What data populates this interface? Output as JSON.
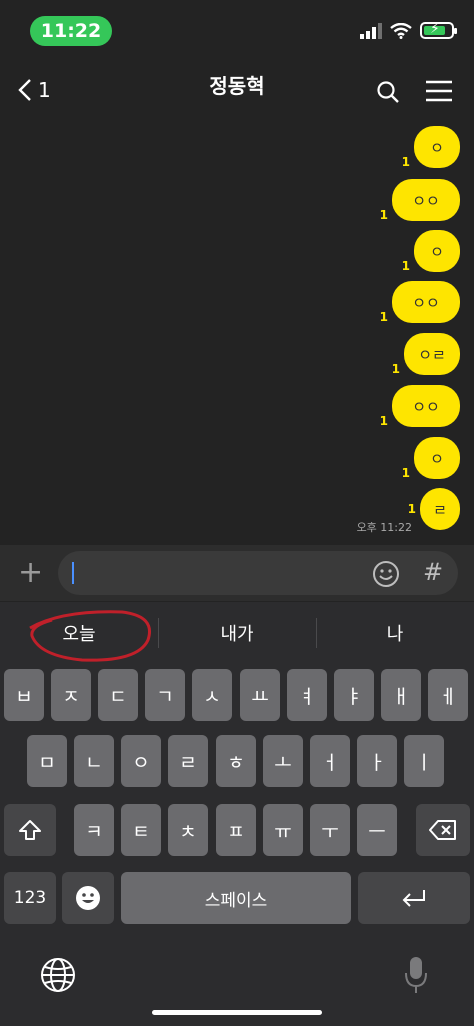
{
  "status_bar": {
    "time": "11:22"
  },
  "header": {
    "back_count": "1",
    "title": "정동혁"
  },
  "messages": [
    {
      "text": "ㅇ",
      "read": "1"
    },
    {
      "text": "ㅇㅇ",
      "read": "1"
    },
    {
      "text": "ㅇ",
      "read": "1"
    },
    {
      "text": "ㅇㅇ",
      "read": "1"
    },
    {
      "text": "ㅇㄹ",
      "read": "1"
    },
    {
      "text": "ㅇㅇ",
      "read": "1"
    },
    {
      "text": "ㅇ",
      "read": "1"
    },
    {
      "text": "ㄹ",
      "read": "1"
    }
  ],
  "timestamp": "오후 11:22",
  "input_bar": {
    "plus": "+",
    "hash": "#"
  },
  "suggestions": [
    "오늘",
    "내가",
    "나"
  ],
  "keyboard": {
    "row1": [
      "ㅂ",
      "ㅈ",
      "ㄷ",
      "ㄱ",
      "ㅅ",
      "ㅛ",
      "ㅕ",
      "ㅑ",
      "ㅐ",
      "ㅔ"
    ],
    "row2": [
      "ㅁ",
      "ㄴ",
      "ㅇ",
      "ㄹ",
      "ㅎ",
      "ㅗ",
      "ㅓ",
      "ㅏ",
      "ㅣ"
    ],
    "row3": [
      "ㅋ",
      "ㅌ",
      "ㅊ",
      "ㅍ",
      "ㅠ",
      "ㅜ",
      "ㅡ"
    ],
    "numbers_label": "123",
    "space_label": "스페이스"
  },
  "colors": {
    "bubble": "#fee500",
    "accent_green": "#35c759",
    "annotation_red": "#c0202a"
  }
}
